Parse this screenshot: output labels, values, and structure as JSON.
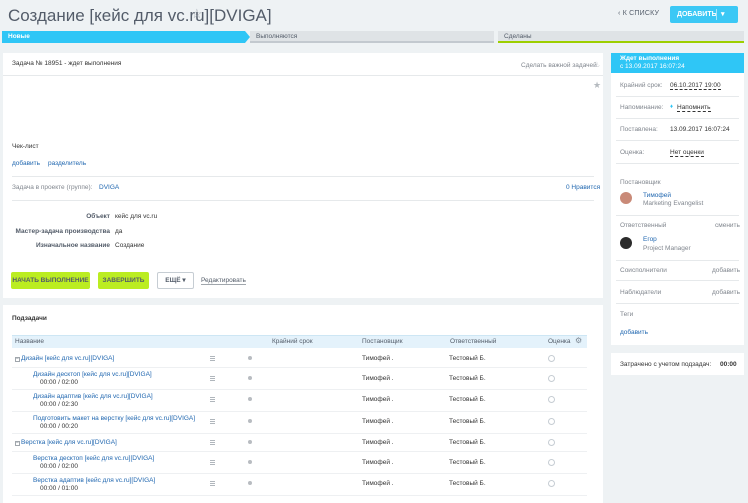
{
  "header": {
    "title": "Создание [кейс для vc.ru][DVIGA]",
    "to_list": "К СПИСКУ",
    "add_button": "ДОБАВИТЬ"
  },
  "stages": [
    "Новые",
    "Выполняются",
    "Сделаны"
  ],
  "task": {
    "id_line": "Задача № 18951 - ждет выполнения",
    "make_important": "Сделать важной задачей",
    "checklist_label": "Чек-лист",
    "checklist_add": "добавить",
    "checklist_separator": "разделитель",
    "project_label": "Задача в проекте (группе):",
    "project_name": "DVIGA",
    "likes": "0 Нравится",
    "fields": [
      {
        "label": "Объект",
        "value": "кейс для vc.ru"
      },
      {
        "label": "Мастер-задача производства",
        "value": "да"
      },
      {
        "label": "Изначальное название",
        "value": "Создание"
      }
    ],
    "btn_start": "НАЧАТЬ ВЫПОЛНЕНИЕ",
    "btn_finish": "ЗАВЕРШИТЬ",
    "btn_more": "ЕЩЁ",
    "btn_edit": "Редактировать"
  },
  "subtasks": {
    "title": "Подзадачи",
    "columns": [
      "Название",
      "Крайний срок",
      "Постановщик",
      "Ответственный",
      "Оценка"
    ],
    "rows": [
      {
        "name": "Дизайн [кейс для vc.ru][DVIGA]",
        "time": "",
        "creator": "Тимофей .",
        "responsible": "Тестовый Б.",
        "group": true
      },
      {
        "name": "Дизайн десктоп [кейс для vc.ru][DVIGA]",
        "time": "00:00 / 02:00",
        "creator": "Тимофей .",
        "responsible": "Тестовый Б.",
        "group": false
      },
      {
        "name": "Дизайн адаптив [кейс для vc.ru][DVIGA]",
        "time": "00:00 / 02:30",
        "creator": "Тимофей .",
        "responsible": "Тестовый Б.",
        "group": false
      },
      {
        "name": "Подготовить макет на верстку [кейс для vc.ru][DVIGA]",
        "time": "00:00 / 00:20",
        "creator": "Тимофей .",
        "responsible": "Тестовый Б.",
        "group": false
      },
      {
        "name": "Верстка [кейс для vc.ru][DVIGA]",
        "time": "",
        "creator": "Тимофей .",
        "responsible": "Тестовый Б.",
        "group": true
      },
      {
        "name": "Верстка десктоп [кейс для vc.ru][DVIGA]",
        "time": "00:00 / 02:00",
        "creator": "Тимофей .",
        "responsible": "Тестовый Б.",
        "group": false
      },
      {
        "name": "Верстка адаптив [кейс для vc.ru][DVIGA]",
        "time": "00:00 / 01:00",
        "creator": "Тимофей .",
        "responsible": "Тестовый Б.",
        "group": false
      }
    ]
  },
  "sidebar": {
    "status_title": "Ждет выполнения",
    "status_since": "с 13.09.2017 16:07:24",
    "deadline_label": "Крайний срок:",
    "deadline_value": "06.10.2017 19:00",
    "remind_label": "Напоминание:",
    "remind_value": "Напомнить",
    "created_label": "Поставлена:",
    "created_value": "13.09.2017 16:07:24",
    "rating_label": "Оценка:",
    "rating_value": "Нет оценки",
    "creator_section": "Постановщик",
    "creator_name": "Тимофей",
    "creator_role": "Marketing Evangelist",
    "responsible_section": "Ответственный",
    "responsible_change": "сменить",
    "responsible_name": "Егор",
    "responsible_role": "Project Manager",
    "coexec_label": "Соисполнители",
    "coexec_add": "добавить",
    "observers_label": "Наблюдатели",
    "observers_add": "добавить",
    "tags_label": "Теги",
    "tags_add": "добавить",
    "time_label": "Затрачено с учетом подзадач:",
    "time_value": "00:00"
  }
}
